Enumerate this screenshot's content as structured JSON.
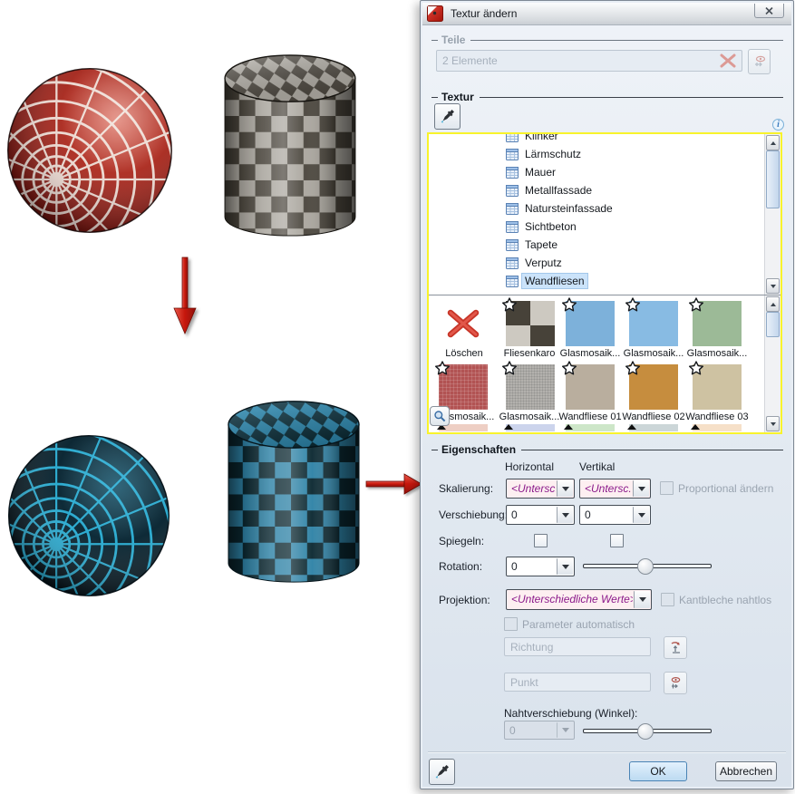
{
  "window": {
    "title": "Textur ändern"
  },
  "icons": {
    "info": "i"
  },
  "teile": {
    "caption": "Teile",
    "elements_placeholder": "2 Elemente"
  },
  "textur": {
    "caption": "Textur",
    "list": [
      {
        "label": "Klinker"
      },
      {
        "label": "Lärmschutz"
      },
      {
        "label": "Mauer"
      },
      {
        "label": "Metallfassade"
      },
      {
        "label": "Natursteinfassade"
      },
      {
        "label": "Sichtbeton"
      },
      {
        "label": "Tapete"
      },
      {
        "label": "Verputz"
      },
      {
        "label": "Wandfliesen",
        "selected": true
      }
    ],
    "tiles_row1": [
      {
        "label": "Löschen"
      },
      {
        "label": "Fliesenkaro"
      },
      {
        "label": "Glasmosaik..."
      },
      {
        "label": "Glasmosaik..."
      },
      {
        "label": "Glasmosaik..."
      }
    ],
    "tiles_row2": [
      {
        "label": "Glasmosaik..."
      },
      {
        "label": "Glasmosaik..."
      },
      {
        "label": "Wandfliese 01"
      },
      {
        "label": "Wandfliese 02"
      },
      {
        "label": "Wandfliese 03"
      }
    ]
  },
  "eigenschaften": {
    "caption": "Eigenschaften",
    "col_horizontal": "Horizontal",
    "col_vertikal": "Vertikal",
    "skalierung_label": "Skalierung:",
    "skalierung_h": "<Untersc...",
    "skalierung_v": "<Untersc...",
    "proportional_label": "Proportional ändern",
    "verschiebung_label": "Verschiebung:",
    "verschiebung_h": "0",
    "verschiebung_v": "0",
    "spiegeln_label": "Spiegeln:",
    "rotation_label": "Rotation:",
    "rotation_value": "0",
    "projektion_label": "Projektion:",
    "projektion_value": "<Unterschiedliche Werte>",
    "kantbleche_label": "Kantbleche nahtlos",
    "parameter_label": "Parameter automatisch",
    "richtung_placeholder": "Richtung",
    "punkt_placeholder": "Punkt",
    "naht_label": "Nahtverschiebung (Winkel):",
    "naht_value": "0"
  },
  "footer": {
    "ok": "OK",
    "cancel": "Abbrechen"
  },
  "colors": {
    "highlight_border": "#f8f32b",
    "selection_bg": "#cbe3fa",
    "modified_field_bg": "#fdeff1",
    "modified_field_text": "#8b1a8b",
    "arrow_red": "#cf2a1b",
    "dialog_bg": "#dbe4ee",
    "sphere_red": "#a3241c",
    "sphere_blue_line": "#2fb3d9",
    "cyl_gray_dark": "#474239",
    "cyl_gray_light": "#a8a49c",
    "cyl_blue_dark": "#0b2831",
    "cyl_blue_light": "#2e82a6"
  }
}
